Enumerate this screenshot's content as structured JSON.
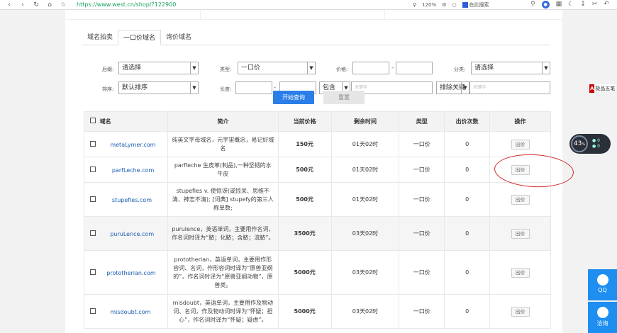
{
  "browser": {
    "url": "https://www.west.cn/shop/?122900",
    "zoom": "120%",
    "search_label": "在此搜索"
  },
  "tabs": [
    {
      "label": "域名拍卖",
      "active": false
    },
    {
      "label": "一口价域名",
      "active": true
    },
    {
      "label": "询价域名",
      "active": false
    }
  ],
  "filters": {
    "suffix_label": "后缀:",
    "suffix_value": "请选择",
    "type_label": "类型:",
    "type_value": "一口价",
    "price_label": "价格:",
    "category_label": "分类:",
    "category_value": "请选择",
    "sort_label": "排序:",
    "sort_value": "默认排序",
    "length_label": "长度:",
    "contains_value": "包含",
    "keyword_placeholder": "关键字",
    "exclude_value": "排除关键",
    "keyword2_placeholder": "关键字"
  },
  "buttons": {
    "search": "开始查询",
    "reset": "重置"
  },
  "table": {
    "headers": [
      "域名",
      "简介",
      "当前价格",
      "剩余时间",
      "类型",
      "出价次数",
      "操作"
    ],
    "rows": [
      {
        "domain": "metaLymer.com",
        "desc": "纯英文字母域名，元宇宙概念，易记好域名",
        "price": "150元",
        "time": "01天02时",
        "type": "一口价",
        "bids": "0",
        "action": "出价"
      },
      {
        "domain": "parfLeche.com",
        "desc": "parfleche 生皮革(制品),一种坚韧的水牛皮",
        "price": "500元",
        "time": "01天02时",
        "type": "一口价",
        "bids": "0",
        "action": "出价"
      },
      {
        "domain": "stupefies.com",
        "desc": "stupefies v. 使惊讶(或惊呆、思维不清、神志不清); [词典] stupefy的第三人称单数;",
        "price": "500元",
        "time": "01天02时",
        "type": "一口价",
        "bids": "0",
        "action": "出价"
      },
      {
        "domain": "puruLence.com",
        "desc": "purulence，英语单词，主要用作名词，作名词时译为“脓；化脓；含脓；流脓”。",
        "price": "3500元",
        "time": "03天02时",
        "type": "一口价",
        "bids": "0",
        "action": "出价"
      },
      {
        "domain": "prototherian.com",
        "desc": "prototherian，英语单词，主要用作形容词、名词，作形容词时译为“原兽亚纲的”，作名词时译为“原兽亚纲动物”，原兽类。",
        "price": "5000元",
        "time": "03天02时",
        "type": "一口价",
        "bids": "0",
        "action": "出价"
      },
      {
        "domain": "misdoubt.com",
        "desc": "misdoubt，英语单词，主要用作及物动词、名词，作及物动词时译为“怀疑；担心”，作名词时译为“怀疑；疑虑”。",
        "price": "5000元",
        "time": "03天02时",
        "type": "一口价",
        "bids": "0",
        "action": "出价"
      }
    ]
  },
  "side": {
    "link_badge": "A",
    "link_text": "极品五笔",
    "speed_value": "43",
    "speed_unit": "%",
    "qq_label": "QQ",
    "chat_label": "洽询"
  }
}
